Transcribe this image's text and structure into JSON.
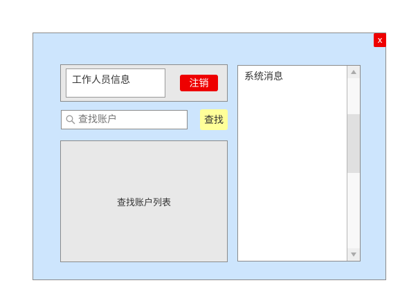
{
  "dialog": {
    "close_label": "x"
  },
  "staff": {
    "info_label": "工作人员信息",
    "logout_label": "注销"
  },
  "search": {
    "placeholder": "查找账户",
    "button_label": "查找"
  },
  "account_list": {
    "label": "查找账户列表"
  },
  "messages": {
    "title": "系统消息"
  },
  "icons": {
    "search": "search-icon",
    "scroll_up": "triangle-up-icon",
    "scroll_down": "triangle-down-icon"
  },
  "colors": {
    "dialog_bg": "#cde5fd",
    "danger": "#ee0000",
    "search_button": "#ffff99",
    "panel_bg": "#e8e8e8"
  }
}
